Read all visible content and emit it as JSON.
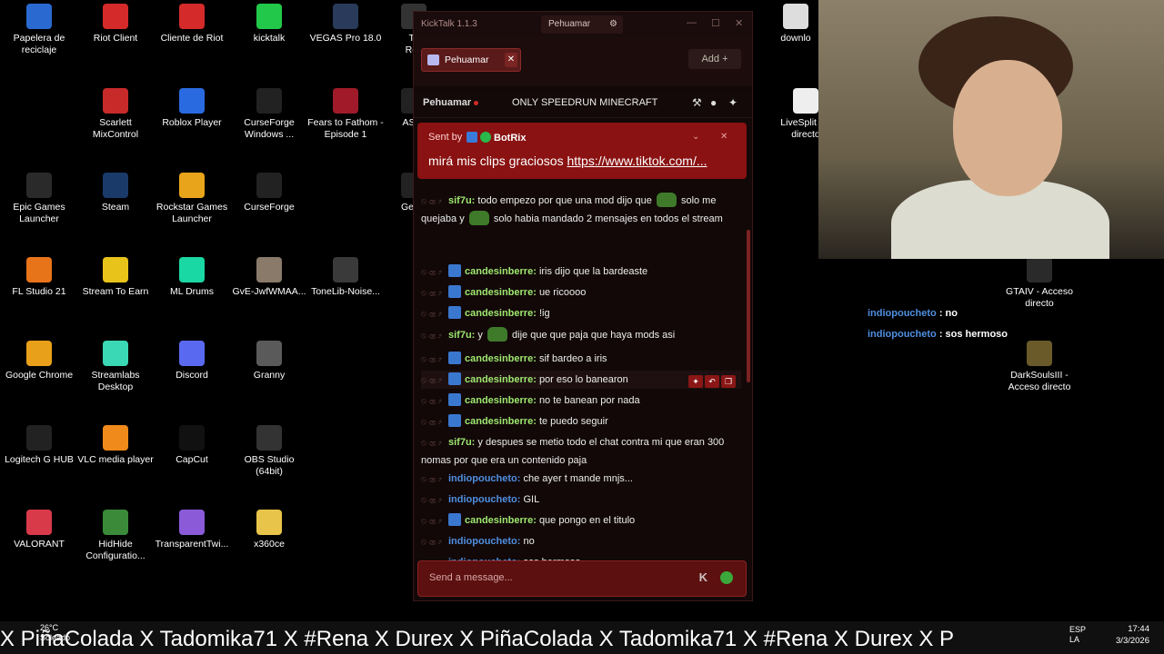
{
  "desktop": {
    "icons": [
      {
        "label": "Papelera de reciclaje",
        "icon": "recycle-bin-icon",
        "color": "#2a6ad0"
      },
      {
        "label": "Riot Client",
        "icon": "riot-icon",
        "color": "#d42a2a"
      },
      {
        "label": "Cliente de Riot",
        "icon": "riot-icon",
        "color": "#d42a2a"
      },
      {
        "label": "kicktalk",
        "icon": "kicktalk-icon",
        "color": "#22c84a"
      },
      {
        "label": "VEGAS Pro 18.0",
        "icon": "vegas-icon",
        "color": "#2a3a5a"
      },
      {
        "label": "Scarlett MixControl",
        "icon": "scarlett-icon",
        "color": "#c82a2a"
      },
      {
        "label": "Roblox Player",
        "icon": "roblox-icon",
        "color": "#2a6ae0"
      },
      {
        "label": "CurseForge Windows ...",
        "icon": "curseforge-icon",
        "color": "#222222"
      },
      {
        "label": "Fears to Fathom - Episode 1",
        "icon": "f2f-icon",
        "color": "#a01a2a"
      },
      {
        "label": "Epic Games Launcher",
        "icon": "epic-icon",
        "color": "#2a2a2a"
      },
      {
        "label": "Steam",
        "icon": "steam-icon",
        "color": "#1a3a6a"
      },
      {
        "label": "Rockstar Games Launcher",
        "icon": "rockstar-icon",
        "color": "#e8a41a"
      },
      {
        "label": "CurseForge",
        "icon": "curseforge-icon",
        "color": "#222222"
      },
      {
        "label": "FL Studio 21",
        "icon": "flstudio-icon",
        "color": "#e8741a"
      },
      {
        "label": "Stream To Earn",
        "icon": "stream-to-earn-icon",
        "color": "#e8c41a"
      },
      {
        "label": "ML Drums",
        "icon": "ml-drums-icon",
        "color": "#1ad8a4"
      },
      {
        "label": "GvE-JwfWMAA...",
        "icon": "image-file-icon",
        "color": "#8a7a6a"
      },
      {
        "label": "ToneLib-Noise...",
        "icon": "tonelib-icon",
        "color": "#3a3a3a"
      },
      {
        "label": "Google Chrome",
        "icon": "chrome-icon",
        "color": "#e8a01a"
      },
      {
        "label": "Streamlabs Desktop",
        "icon": "streamlabs-icon",
        "color": "#3ad8b4"
      },
      {
        "label": "Discord",
        "icon": "discord-icon",
        "color": "#5a6af0"
      },
      {
        "label": "Granny",
        "icon": "granny-icon",
        "color": "#5a5a5a"
      },
      {
        "label": "Logitech G HUB",
        "icon": "logitech-icon",
        "color": "#222222"
      },
      {
        "label": "VLC media player",
        "icon": "vlc-icon",
        "color": "#f08a1a"
      },
      {
        "label": "CapCut",
        "icon": "capcut-icon",
        "color": "#111111"
      },
      {
        "label": "OBS Studio (64bit)",
        "icon": "obs-icon",
        "color": "#333333"
      },
      {
        "label": "VALORANT",
        "icon": "valorant-icon",
        "color": "#d83a4a"
      },
      {
        "label": "HidHide Configuratio...",
        "icon": "hidhide-icon",
        "color": "#3a8a3a"
      },
      {
        "label": "TransparentTwi...",
        "icon": "twitch-icon",
        "color": "#8a5ad8"
      },
      {
        "label": "x360ce",
        "icon": "folder-icon",
        "color": "#e8c44a"
      },
      {
        "label": "To\nRec",
        "icon": "partial-icon",
        "color": "#333333"
      },
      {
        "label": "ASIO",
        "icon": "asio-icon",
        "color": "#222222"
      },
      {
        "label": "GeoG",
        "icon": "geog-icon",
        "color": "#222222"
      },
      {
        "label": "downlo",
        "icon": "download-icon",
        "color": "#dddddd"
      },
      {
        "label": "LiveSplit - A directo",
        "icon": "file-icon",
        "color": "#eeeeee"
      },
      {
        "label": "GTAIV - Acceso directo",
        "icon": "gtaiv-icon",
        "color": "#2a2a2a"
      },
      {
        "label": "DarkSoulsIII - Acceso directo",
        "icon": "darksouls-icon",
        "color": "#6a5a2a"
      }
    ]
  },
  "kicktalk": {
    "app_title": "KickTalk 1.1.3",
    "current_user": "Pehuamar",
    "tab": {
      "label": "Pehuamar",
      "close": "✕"
    },
    "add_label": "Add",
    "add_icon": "+",
    "stream": {
      "name": "Pehuamar",
      "title": "ONLY SPEEDRUN MINECRAFT"
    },
    "pinned": {
      "sent_by": "Sent by",
      "bot_name": "BotRix",
      "message": "mirá mis clips graciosos ",
      "link": "https://www.tiktok.com/..."
    },
    "messages": [
      {
        "user": "sif7u:",
        "color": "green",
        "badge": false,
        "text": "todo empezo por que una mod dijo que [emote] solo me quejaba y [emote] solo habia mandado 2 mensajes en todos el stream"
      },
      {
        "user": "candesinberre:",
        "color": "green",
        "badge": true,
        "text": "iris dijo que la bardeaste"
      },
      {
        "user": "candesinberre:",
        "color": "green",
        "badge": true,
        "text": "ue ricoooo"
      },
      {
        "user": "candesinberre:",
        "color": "green",
        "badge": true,
        "text": "!ig"
      },
      {
        "user": "sif7u:",
        "color": "green",
        "badge": false,
        "text": "y [emote] dije que que paja que haya mods asi"
      },
      {
        "user": "candesinberre:",
        "color": "green",
        "badge": true,
        "text": "sif bardeo a iris"
      },
      {
        "user": "candesinberre:",
        "color": "green",
        "badge": true,
        "text": "por eso lo banearon"
      },
      {
        "user": "candesinberre:",
        "color": "green",
        "badge": true,
        "text": "no te banean por nada"
      },
      {
        "user": "candesinberre:",
        "color": "green",
        "badge": true,
        "text": "te puedo seguir"
      },
      {
        "user": "sif7u:",
        "color": "green",
        "badge": false,
        "text": "y despues se metio todo el chat contra mi que eran 300 nomas por que era un contenido paja"
      },
      {
        "user": "indiopoucheto:",
        "color": "blue",
        "badge": false,
        "text": "che ayer t mande mnjs..."
      },
      {
        "user": "indiopoucheto:",
        "color": "blue",
        "badge": false,
        "text": "GIL"
      },
      {
        "user": "candesinberre:",
        "color": "green",
        "badge": true,
        "text": "que pongo en el titulo"
      },
      {
        "user": "indiopoucheto:",
        "color": "blue",
        "badge": false,
        "text": "no"
      },
      {
        "user": "indiopoucheto:",
        "color": "blue",
        "badge": false,
        "text": "sos hermoso"
      }
    ],
    "input_placeholder": "Send a message...",
    "colors": {
      "accent": "#8a1212",
      "green_user": "#9fe870",
      "blue_user": "#4f8fe0"
    }
  },
  "overlay_chat": [
    {
      "user": "indiopoucheto",
      "text": " : no"
    },
    {
      "user": "indiopoucheto",
      "text": " : sos hermoso"
    }
  ],
  "taskbar": {
    "marquee": "X PiñaColada X Tadomika71 X #Rena X Durex X PiñaColada X Tadomika71 X #Rena X Durex X P",
    "weather_temp": "26°C",
    "weather_text": "Soleado",
    "lang_1": "ESP",
    "lang_2": "LA",
    "time": "17:44",
    "date": "3/3/2026"
  }
}
